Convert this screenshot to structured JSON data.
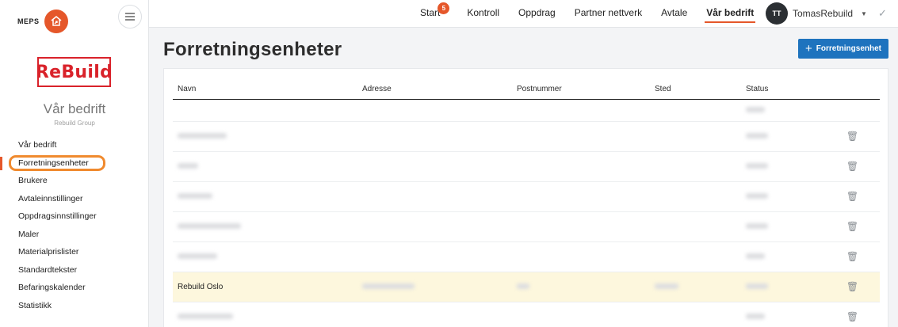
{
  "brand": {
    "name": "MEPS",
    "logo_icon": "home-arrow-icon",
    "color": "#e5572a"
  },
  "sidebar": {
    "company_logo_text": "ReBuild",
    "company_name": "Vår bedrift",
    "company_sub": "Rebuild Group",
    "items": [
      {
        "label": "Vår bedrift"
      },
      {
        "label": "Forretningsenheter",
        "active": true
      },
      {
        "label": "Brukere"
      },
      {
        "label": "Avtaleinnstillinger"
      },
      {
        "label": "Oppdragsinnstillinger"
      },
      {
        "label": "Maler"
      },
      {
        "label": "Materialprislister"
      },
      {
        "label": "Standardtekster"
      },
      {
        "label": "Befaringskalender"
      },
      {
        "label": "Statistikk"
      }
    ]
  },
  "topnav": {
    "items": [
      {
        "label": "Start",
        "badge": "5"
      },
      {
        "label": "Kontroll"
      },
      {
        "label": "Oppdrag"
      },
      {
        "label": "Partner nettverk"
      },
      {
        "label": "Avtale"
      },
      {
        "label": "Vår bedrift",
        "active": true
      }
    ],
    "user": {
      "initials": "TT",
      "name": "TomasRebuild"
    }
  },
  "main": {
    "title": "Forretningsenheter",
    "add_button": "Forretningsenhet",
    "table": {
      "headers": [
        "Navn",
        "Adresse",
        "Postnummer",
        "Sted",
        "Status"
      ],
      "highlighted_row_name": "Rebuild Oslo"
    }
  },
  "colors": {
    "accent": "#e5572a",
    "primary_button": "#1e73be",
    "highlight_row": "#fdf7dd",
    "focus_ring": "#f08a2e"
  }
}
